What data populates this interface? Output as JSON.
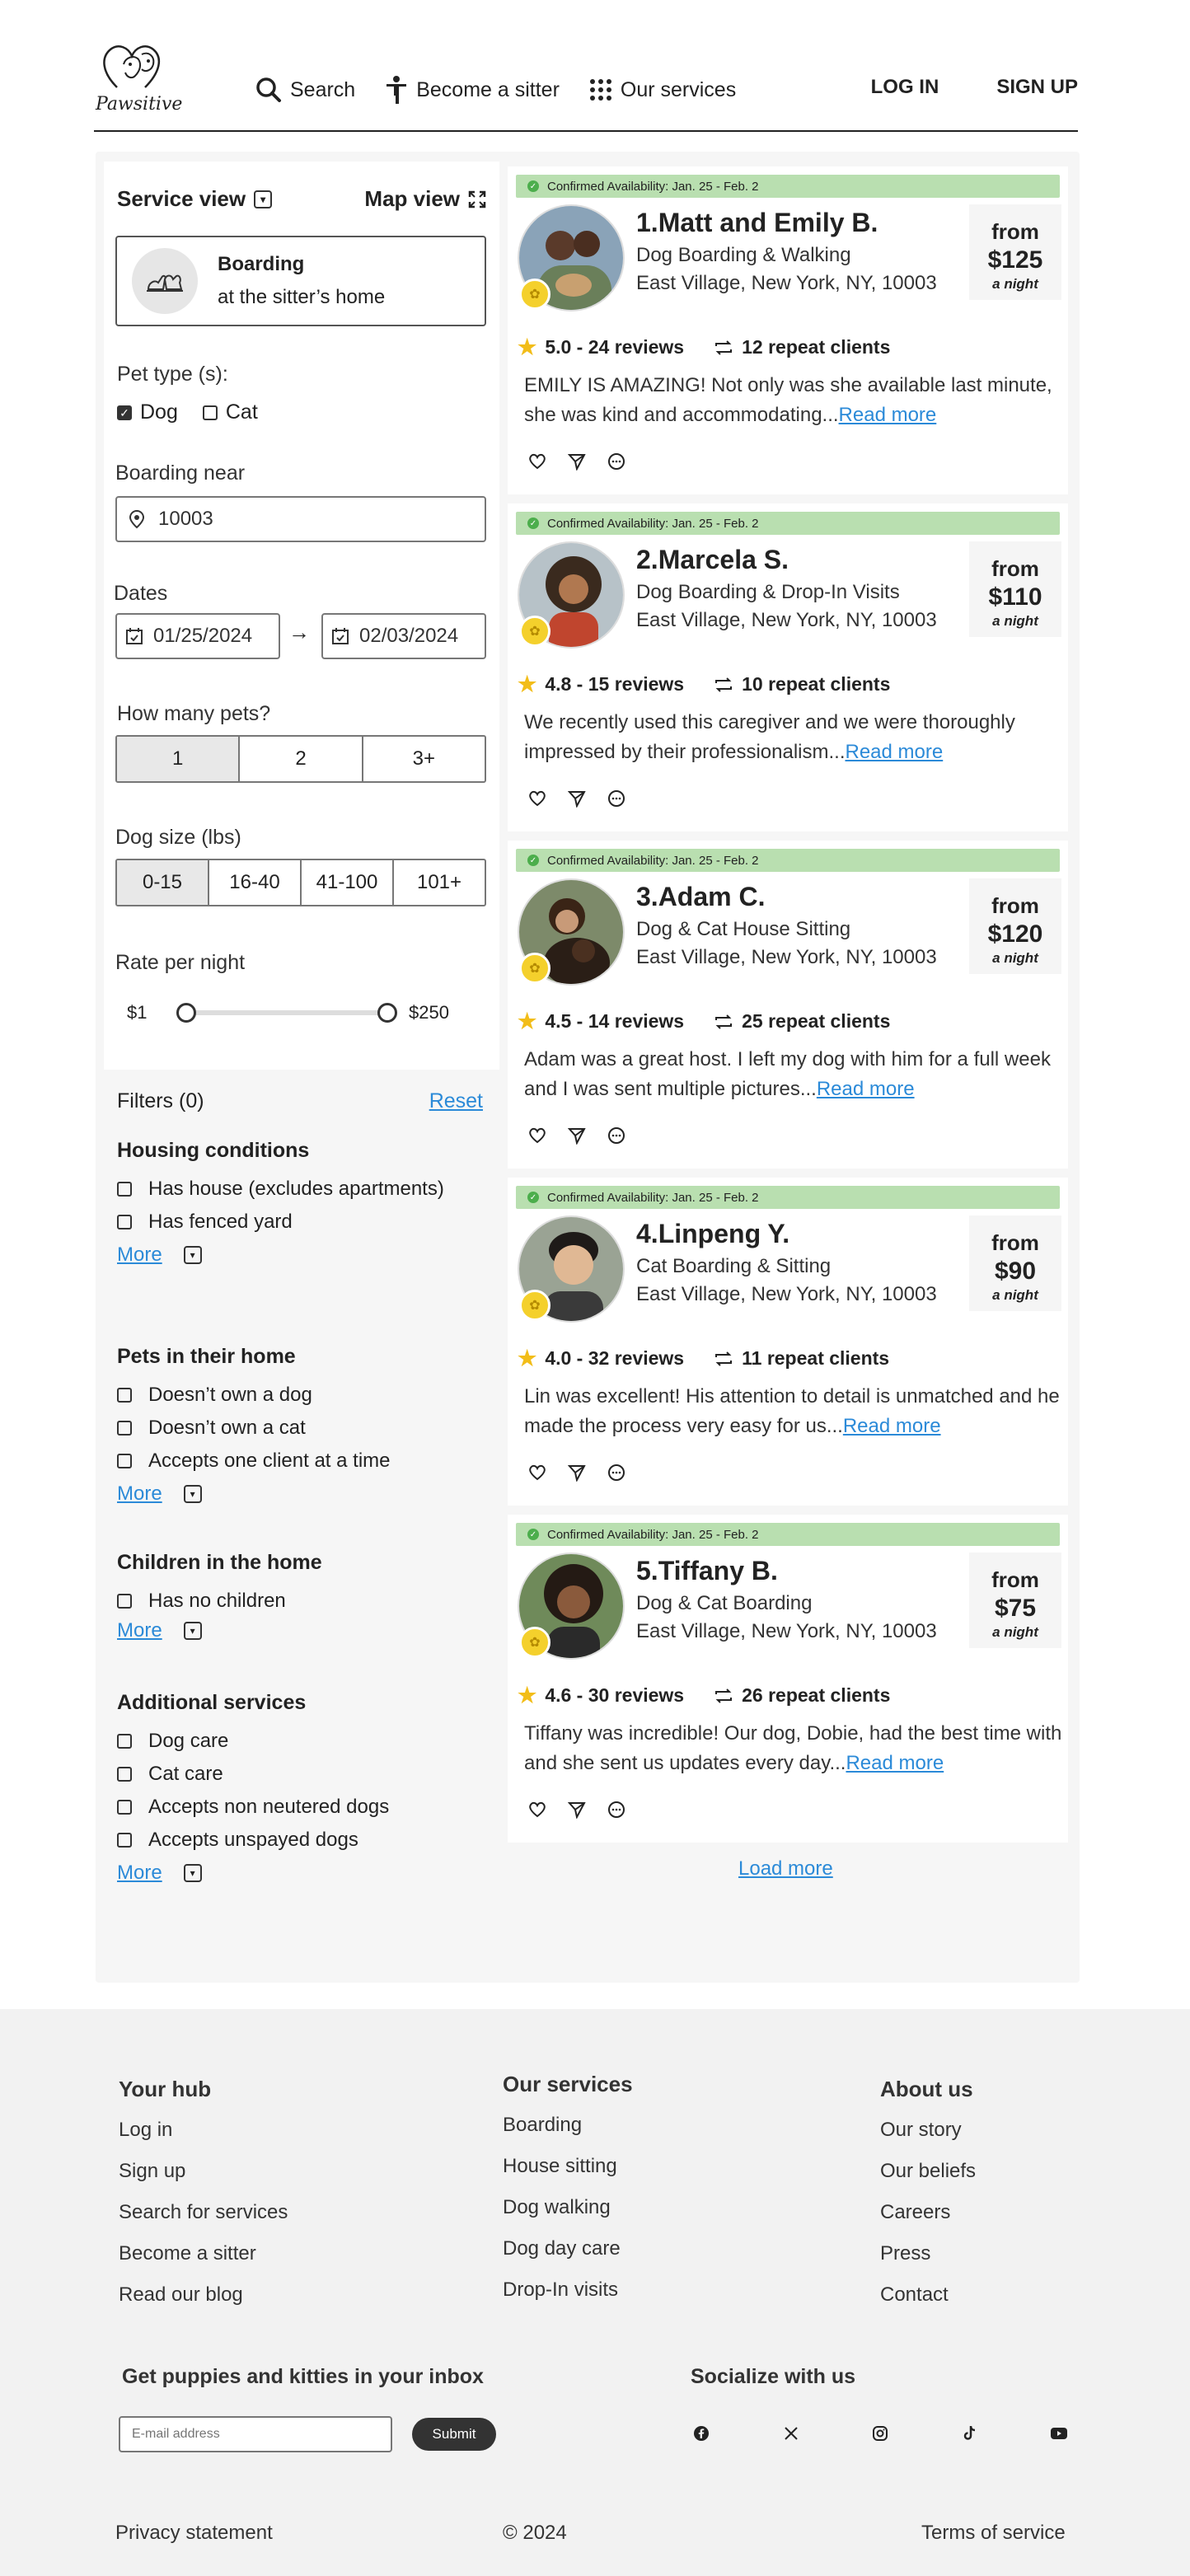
{
  "header": {
    "logo_text": "Pawsitive",
    "nav": [
      {
        "label": "Search",
        "icon": "search-icon"
      },
      {
        "label": "Become a sitter",
        "icon": "person-icon"
      },
      {
        "label": "Our services",
        "icon": "grid-icon"
      }
    ],
    "login": "LOG IN",
    "signup": "SIGN UP"
  },
  "sidebar": {
    "service_view": "Service view",
    "map_view": "Map view",
    "service": {
      "title": "Boarding",
      "subtitle": "at the sitter’s home"
    },
    "pet_type_label": "Pet type (s):",
    "pet_types": [
      {
        "label": "Dog",
        "checked": true
      },
      {
        "label": "Cat",
        "checked": false
      }
    ],
    "boarding_near_label": "Boarding near",
    "zip": "10003",
    "dates_label": "Dates",
    "start_date": "01/25/2024",
    "end_date": "02/03/2024",
    "date_arrow": "→",
    "pets_label": "How many pets?",
    "pets_options": [
      "1",
      "2",
      "3+"
    ],
    "pets_selected": 0,
    "size_label": "Dog size (lbs)",
    "size_options": [
      "0-15",
      "16-40",
      "41-100",
      "101+"
    ],
    "size_selected": 0,
    "rate_label": "Rate per night",
    "rate_min": "$1",
    "rate_max": "$250"
  },
  "filters": {
    "title": "Filters (0)",
    "reset": "Reset",
    "more": "More",
    "sections": [
      {
        "title": "Housing conditions",
        "items": [
          "Has house (excludes apartments)",
          "Has fenced yard"
        ]
      },
      {
        "title": "Pets in their home",
        "items": [
          "Doesn’t own a dog",
          "Doesn’t own a cat",
          "Accepts one client at a time"
        ]
      },
      {
        "title": "Children in the home",
        "items": [
          "Has no children"
        ]
      },
      {
        "title": "Additional services",
        "items": [
          "Dog care",
          "Cat care",
          "Accepts non neutered dogs",
          "Accepts unspayed dogs"
        ]
      }
    ]
  },
  "listings": [
    {
      "availability": "Confirmed Availability:  Jan. 25 - Feb. 2",
      "name": "1.Matt and Emily B.",
      "service": "Dog Boarding & Walking",
      "location": "East Village, New York, NY, 10003",
      "from": "from",
      "price": "$125",
      "per": "a night",
      "rating": "5.0 - 24 reviews",
      "repeat": "12 repeat clients",
      "review": "EMILY IS AMAZING! Not only was she available last minute, she was kind and accommodating...",
      "read_more": "Read more"
    },
    {
      "availability": "Confirmed Availability:  Jan. 25 - Feb. 2",
      "name": "2.Marcela S.",
      "service": "Dog Boarding & Drop-In Visits",
      "location": "East Village, New York, NY, 10003",
      "from": "from",
      "price": "$110",
      "per": "a night",
      "rating": "4.8 - 15 reviews",
      "repeat": "10 repeat clients",
      "review": "We recently used this caregiver and we were thoroughly impressed by their professionalism...",
      "read_more": "Read more"
    },
    {
      "availability": "Confirmed Availability:  Jan. 25 - Feb. 2",
      "name": "3.Adam C.",
      "service": "Dog & Cat House Sitting",
      "location": "East Village, New York, NY, 10003",
      "from": "from",
      "price": "$120",
      "per": "a night",
      "rating": "4.5 - 14 reviews",
      "repeat": "25 repeat clients",
      "review": "Adam was a great host. I left my dog with him for a full week and I was sent multiple pictures...",
      "read_more": "Read more"
    },
    {
      "availability": "Confirmed Availability:  Jan. 25 - Feb. 2",
      "name": "4.Linpeng Y.",
      "service": "Cat Boarding & Sitting",
      "location": "East Village, New York, NY, 10003",
      "from": "from",
      "price": "$90",
      "per": "a night",
      "rating": "4.0 - 32 reviews",
      "repeat": "11 repeat clients",
      "review": "Lin was excellent! His attention to detail is unmatched and he made the process very easy for us...",
      "read_more": "Read more"
    },
    {
      "availability": "Confirmed Availability:  Jan. 25 - Feb. 2",
      "name": "5.Tiffany B.",
      "service": "Dog & Cat Boarding",
      "location": "East Village, New York, NY, 10003",
      "from": "from",
      "price": "$75",
      "per": "a night",
      "rating": "4.6 - 30 reviews",
      "repeat": "26 repeat clients",
      "review": "Tiffany was incredible! Our dog, Dobie, had the best time with and she sent us updates every day...",
      "read_more": "Read more"
    }
  ],
  "load_more": "Load more",
  "footer": {
    "hub": {
      "title": "Your hub",
      "links": [
        "Log in",
        "Sign up",
        "Search for services",
        "Become a sitter",
        "Read our blog"
      ]
    },
    "services": {
      "title": "Our services",
      "links": [
        "Boarding",
        "House sitting",
        "Dog walking",
        "Dog day care",
        "Drop-In visits"
      ]
    },
    "about": {
      "title": "About us",
      "links": [
        "Our story",
        "Our beliefs",
        "Careers",
        "Press",
        "Contact"
      ]
    },
    "newsletter_title": "Get puppies and kitties in your inbox",
    "email_placeholder": "E-mail address",
    "submit": "Submit",
    "social_title": "Socialize with us",
    "social_icons": [
      "facebook-icon",
      "x-icon",
      "instagram-icon",
      "tiktok-icon",
      "youtube-icon"
    ],
    "privacy": "Privacy statement",
    "copyright": "© 2024",
    "terms": "Terms of service"
  },
  "colors": {
    "availability_bar": "#b9dfb0",
    "link": "#2b8ad8",
    "star": "#f2bd19",
    "badge": "#f4d02c"
  }
}
